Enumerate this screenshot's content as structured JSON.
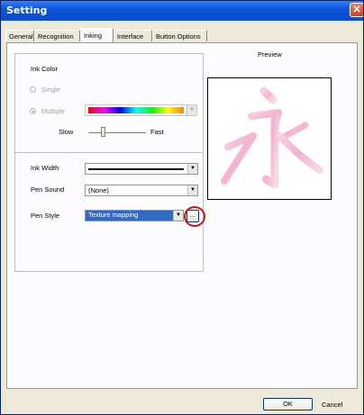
{
  "window": {
    "title": "Setting",
    "close_glyph": "✕"
  },
  "tabs": [
    {
      "label": "General"
    },
    {
      "label": "Recognition"
    },
    {
      "label": "Inking"
    },
    {
      "label": "Interface"
    },
    {
      "label": "Button Options"
    }
  ],
  "ink_color": {
    "group_label": "Ink Color",
    "single_label": "Single",
    "multiple_label": "Multiple",
    "selected_mode": "Multiple",
    "slow_label": "Slow",
    "fast_label": "Fast",
    "speed_slider_fraction": 0.25
  },
  "ink_width": {
    "label": "Ink Width"
  },
  "pen_sound": {
    "label": "Pen Sound",
    "value": "(None)"
  },
  "pen_style": {
    "label": "Pen Style",
    "value": "Texture mapping",
    "browse_label": "..."
  },
  "preview": {
    "label": "Preview",
    "sample_char": "永",
    "ink_color": "#f2a6c8"
  },
  "buttons": {
    "ok_label": "OK",
    "cancel_label": "Cancel"
  },
  "colors": {
    "titlebar": "#0a55d8",
    "selection": "#316ac5",
    "highlight_ring": "#d01010"
  }
}
